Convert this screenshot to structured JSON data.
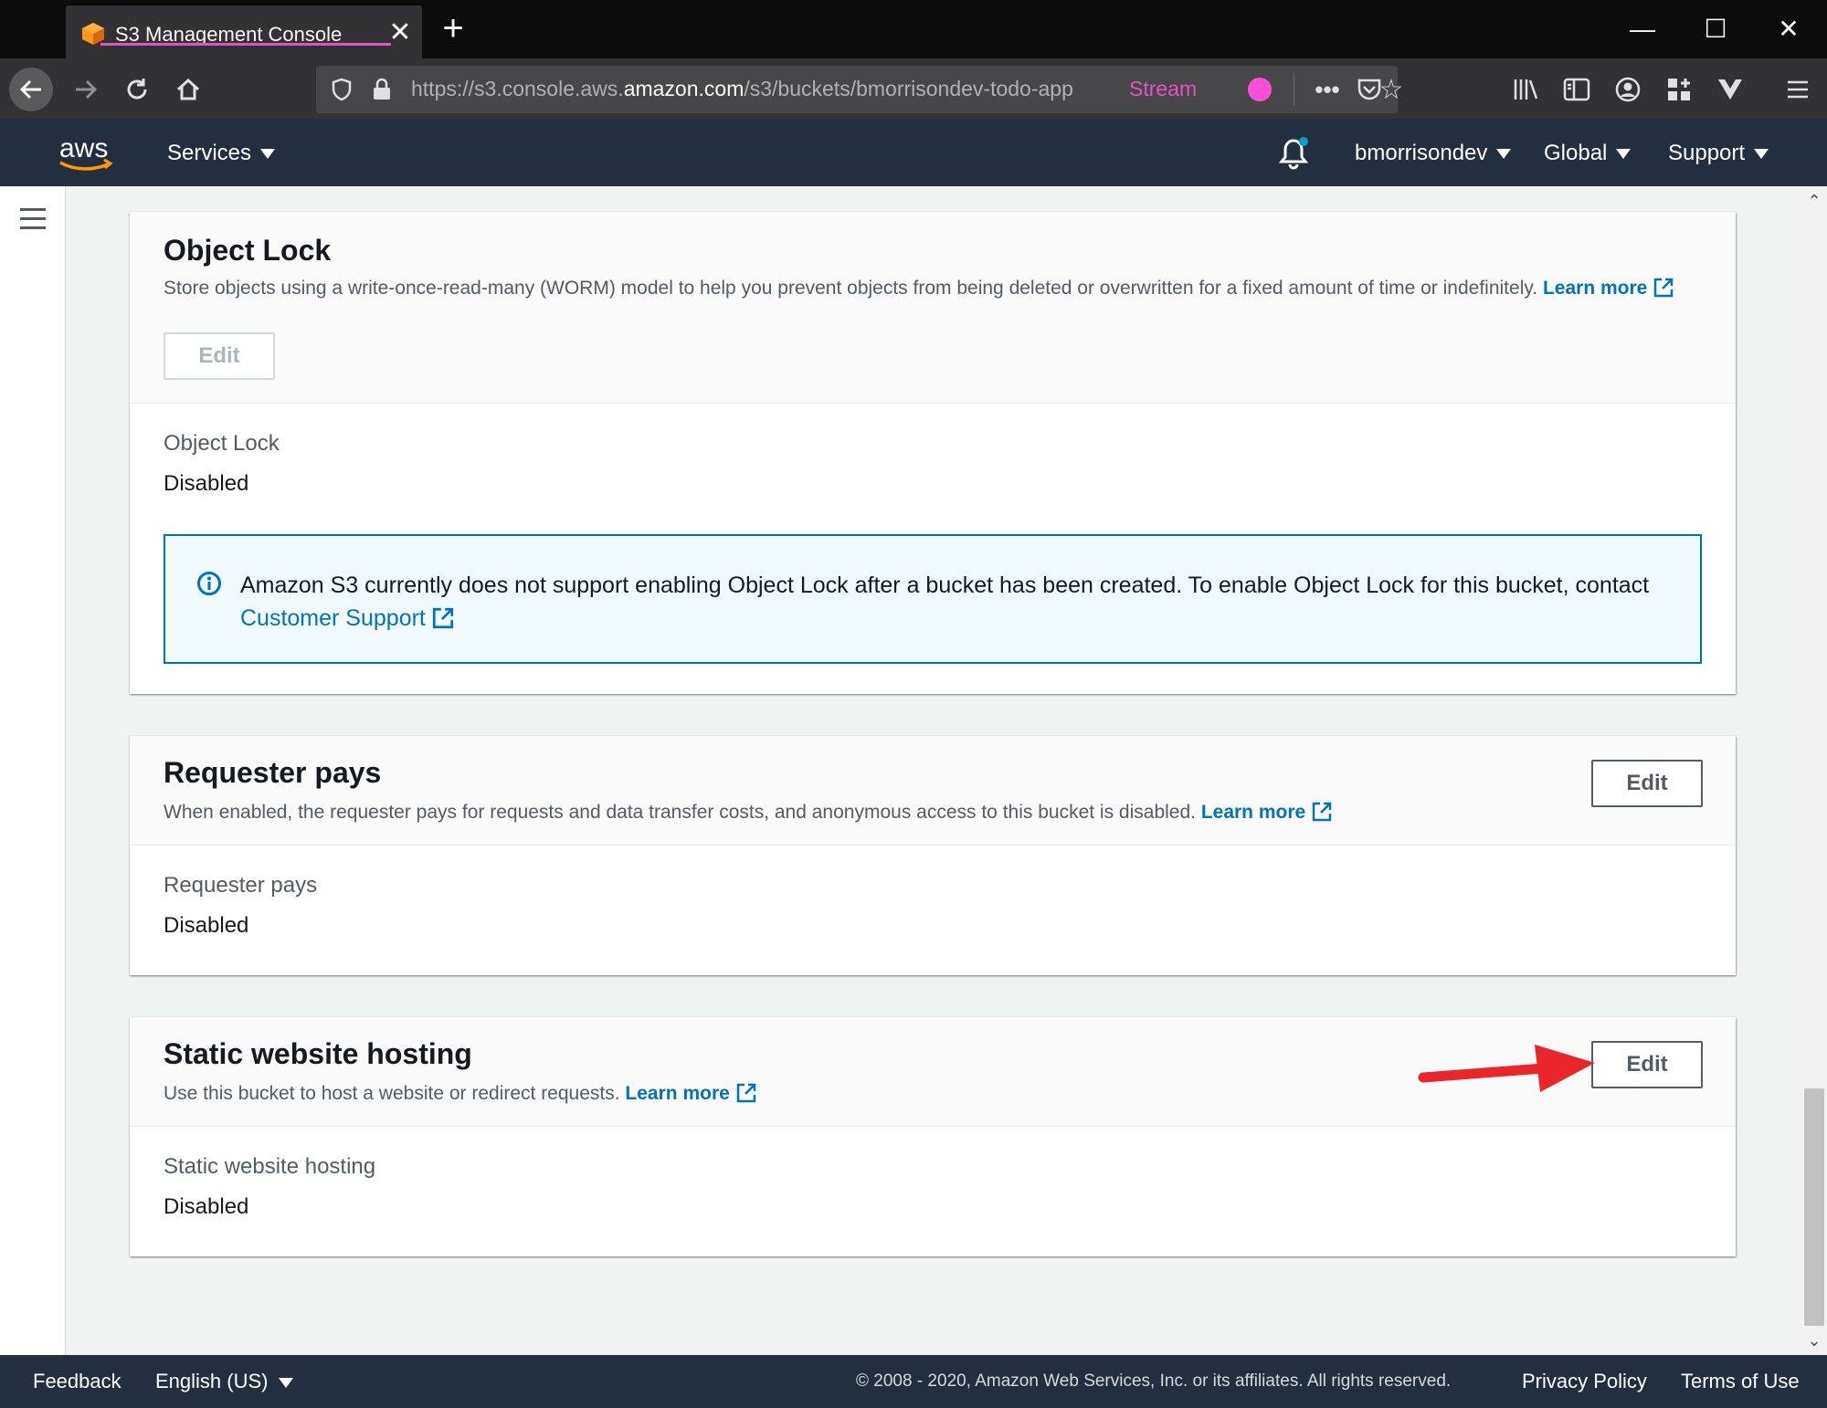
{
  "browser": {
    "tab_title": "S3 Management Console",
    "url_prefix": "https://s3.console.aws.",
    "url_domain": "amazon.com",
    "url_path": "/s3/buckets/bmorrisondev-todo-app",
    "stream_label": "Stream",
    "accent_color": "#e054c0"
  },
  "aws_header": {
    "services_label": "Services",
    "account_label": "bmorrisondev",
    "region_label": "Global",
    "support_label": "Support"
  },
  "panels": {
    "object_lock": {
      "title": "Object Lock",
      "description": "Store objects using a write-once-read-many (WORM) model to help you prevent objects from being deleted or overwritten for a fixed amount of time or indefinitely.",
      "learn_more": "Learn more",
      "edit_label": "Edit",
      "field_label": "Object Lock",
      "field_value": "Disabled",
      "info_text": "Amazon S3 currently does not support enabling Object Lock after a bucket has been created. To enable Object Lock for this bucket, contact",
      "info_link": "Customer Support"
    },
    "requester_pays": {
      "title": "Requester pays",
      "description": "When enabled, the requester pays for requests and data transfer costs, and anonymous access to this bucket is disabled.",
      "learn_more": "Learn more",
      "edit_label": "Edit",
      "field_label": "Requester pays",
      "field_value": "Disabled"
    },
    "static_website": {
      "title": "Static website hosting",
      "description": "Use this bucket to host a website or redirect requests.",
      "learn_more": "Learn more",
      "edit_label": "Edit",
      "field_label": "Static website hosting",
      "field_value": "Disabled"
    }
  },
  "footer": {
    "feedback": "Feedback",
    "language": "English (US)",
    "copyright": "© 2008 - 2020, Amazon Web Services, Inc. or its affiliates. All rights reserved.",
    "privacy": "Privacy Policy",
    "terms": "Terms of Use"
  },
  "colors": {
    "aws_navy": "#232f3e",
    "link_blue": "#0073bb",
    "annotation_red": "#e8262b"
  }
}
